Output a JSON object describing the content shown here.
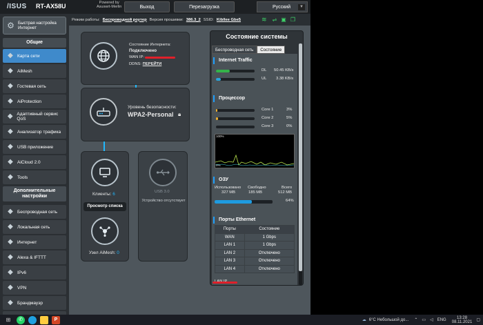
{
  "header": {
    "brand": "/ISUS",
    "model": "RT-AX58U",
    "powered_line1": "Powered by",
    "powered_line2": "Asuswrt-Merlin",
    "logout_label": "Выход",
    "reboot_label": "Перезагрузка",
    "language": "Русский"
  },
  "modebar": {
    "mode_label": "Режим работы:",
    "mode_value": "Беспроводной роутер",
    "firmware_label": "Версия прошивки:",
    "firmware_value": "386.3_2",
    "ssid_label": "SSID:",
    "ssid_value": "Kibllee Gbe5"
  },
  "sidebar": {
    "quick_setup": "Быстрая настройка Интернет",
    "general_header": "Общие",
    "general_items": [
      {
        "label": "Карта сети",
        "icon": "network-map-icon"
      },
      {
        "label": "AiMesh",
        "icon": "aimesh-icon"
      },
      {
        "label": "Гостевая сеть",
        "icon": "guest-network-icon"
      },
      {
        "label": "AiProtection",
        "icon": "aiprotection-icon"
      },
      {
        "label": "Адаптивный сервис QoS",
        "icon": "qos-icon"
      },
      {
        "label": "Анализатор трафика",
        "icon": "traffic-analyzer-icon"
      },
      {
        "label": "USB приложение",
        "icon": "usb-app-icon"
      },
      {
        "label": "AiCloud 2.0",
        "icon": "aicloud-icon"
      },
      {
        "label": "Tools",
        "icon": "tools-icon"
      }
    ],
    "advanced_header": "Дополнительные настройки",
    "advanced_items": [
      {
        "label": "Беспроводная сеть",
        "icon": "wireless-icon"
      },
      {
        "label": "Локальная сеть",
        "icon": "lan-icon"
      },
      {
        "label": "Интернет",
        "icon": "wan-icon"
      },
      {
        "label": "Alexa & IFTTT",
        "icon": "alexa-icon"
      },
      {
        "label": "IPv6",
        "icon": "ipv6-icon"
      },
      {
        "label": "VPN",
        "icon": "vpn-icon"
      },
      {
        "label": "Брандмауэр",
        "icon": "firewall-icon"
      },
      {
        "label": "Администри",
        "icon": "admin-icon"
      }
    ]
  },
  "internet_card": {
    "status_label": "Состояние Интернета:",
    "status_value": "Подключено",
    "wan_ip_label": "WAN IP:",
    "ddns_label": "DDNS:",
    "ddns_link": "ПЕРЕЙТИ"
  },
  "router_card": {
    "security_label": "Уровень безопасности:",
    "security_value": "WPA2-Personal"
  },
  "clients_card": {
    "clients_label": "Клиенты:",
    "clients_count": "6",
    "view_list": "Просмотр списка",
    "aimesh_label": "Узел AiMesh:",
    "aimesh_count": "0"
  },
  "usb_card": {
    "usb_label": "USB 3.0",
    "usb_status": "Устройство отсутствует"
  },
  "status_panel": {
    "title": "Состояние системы",
    "tabs": [
      "Беспроводная сеть",
      "Состояние"
    ],
    "traffic": {
      "title": "Internet Traffic",
      "dl_label": "DL",
      "dl_value": "50.45 KB/s",
      "ul_label": "UL",
      "ul_value": "3.38 KB/s",
      "dl_fraction": 0.35,
      "ul_fraction": 0.12
    },
    "cpu": {
      "title": "Процессор",
      "cores": [
        {
          "label": "Core 1",
          "value": "3%",
          "fraction": 0.03
        },
        {
          "label": "Core 2",
          "value": "5%",
          "fraction": 0.05
        },
        {
          "label": "Core 3",
          "value": "0%",
          "fraction": 0.0
        }
      ],
      "graph_top": "100%",
      "graph_bottom": "0%"
    },
    "ram": {
      "title": "ОЗУ",
      "used_label": "Использовано",
      "used_value": "327 MB",
      "free_label": "Свободно",
      "free_value": "185 MB",
      "total_label": "Всего",
      "total_value": "512 MB",
      "percent": "64%",
      "fraction": 0.64
    },
    "ethernet": {
      "title": "Порты Ethernet",
      "headers": [
        "Порты",
        "Состояние"
      ],
      "rows": [
        [
          "WAN",
          "1 Gbps"
        ],
        [
          "LAN 1",
          "1 Gbps"
        ],
        [
          "LAN 2",
          "Отключено"
        ],
        [
          "LAN 3",
          "Отключено"
        ],
        [
          "LAN 4",
          "Отключено"
        ]
      ]
    },
    "lan_ip_label": "LAN IP"
  },
  "taskbar": {
    "weather": "6°C  Небольшой до...",
    "lang": "ENG",
    "time": "13:28",
    "date": "08.11.2021"
  },
  "colors": {
    "accent": "#20b8ff",
    "active_nav": "#3f8acb",
    "dl_bar": "#34b34a",
    "ul_bar": "#2aa3d8",
    "ram_bar": "#1e9be0",
    "redaction": "#e0202a"
  }
}
